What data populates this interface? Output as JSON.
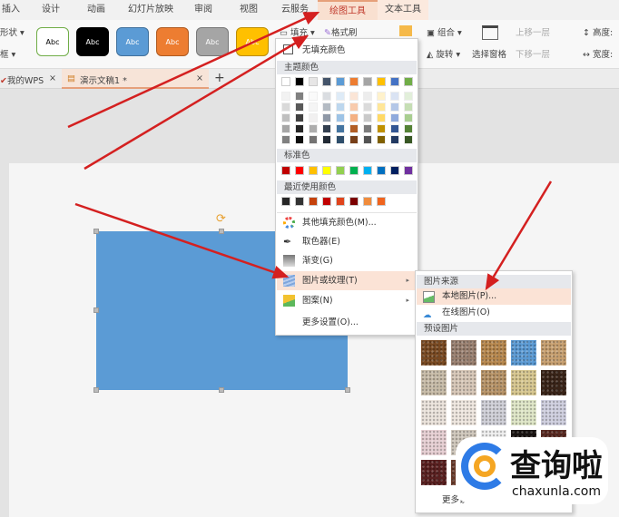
{
  "tabs": [
    {
      "label": "插入"
    },
    {
      "label": "设计"
    },
    {
      "label": "动画"
    },
    {
      "label": "幻灯片放映"
    },
    {
      "label": "审阅"
    },
    {
      "label": "视图"
    },
    {
      "label": "云服务"
    },
    {
      "label": "绘图工具"
    },
    {
      "label": "文本工具"
    }
  ],
  "ribbon": {
    "shape_label": "形状 ▾",
    "frame_label": "框 ▾",
    "style_text": "Abc",
    "styles": [
      {
        "bg": "#ffffff",
        "fg": "#000",
        "border": "#70ad47"
      },
      {
        "bg": "#000000",
        "fg": "#fff",
        "border": "#000"
      },
      {
        "bg": "#5b9bd5",
        "fg": "#fff",
        "border": "#41719c"
      },
      {
        "bg": "#ed7d31",
        "fg": "#fff",
        "border": "#ae5a21"
      },
      {
        "bg": "#a5a5a5",
        "fg": "#fff",
        "border": "#787878"
      },
      {
        "bg": "#ffc000",
        "fg": "#fff",
        "border": "#bc8c00"
      }
    ],
    "fill": "填充",
    "format_painter": "格式刷",
    "group": "组合",
    "rotate": "旋转",
    "selection_pane": "选择窗格",
    "bring_forward": "上移一层",
    "send_backward": "下移一层",
    "height": "高度:",
    "width": "宽度:"
  },
  "doctabs": {
    "my_wps": "我的WPS",
    "doc": "演示文稿1 *",
    "close": "×",
    "add": "+"
  },
  "fill_menu": {
    "no_fill": "无填充颜色",
    "theme_colors": "主题颜色",
    "theme_base": [
      "#ffffff",
      "#000000",
      "#e7e6e6",
      "#44546a",
      "#5b9bd5",
      "#ed7d31",
      "#a5a5a5",
      "#ffc000",
      "#4472c4",
      "#70ad47"
    ],
    "standard_colors": "标准色",
    "standard": [
      "#c00000",
      "#ff0000",
      "#ffc000",
      "#ffff00",
      "#92d050",
      "#00b050",
      "#00b0f0",
      "#0070c0",
      "#002060",
      "#7030a0"
    ],
    "recent_colors": "最近使用颜色",
    "recent": [
      "#262626",
      "#333333",
      "#c5420c",
      "#c00000",
      "#e0441c",
      "#7b0000",
      "#f08c3c",
      "#f0641e"
    ],
    "items": [
      {
        "label": "其他填充颜色(M)...",
        "icon": "color-wheel-icon"
      },
      {
        "label": "取色器(E)",
        "icon": "eyedropper-icon"
      },
      {
        "label": "渐变(G)",
        "icon": "gradient-icon"
      },
      {
        "label": "图片或纹理(T)",
        "icon": "texture-icon",
        "submenu": true
      },
      {
        "label": "图案(N)",
        "icon": "pattern-icon",
        "submenu": true
      },
      {
        "label": "更多设置(O)..."
      }
    ]
  },
  "picture_menu": {
    "source_header": "图片来源",
    "local": "本地图片(P)...",
    "online": "在线图片(O)",
    "preset_header": "预设图片",
    "more": "更多设置(O)...",
    "textures": [
      "#7a4a22",
      "#9a8070",
      "#b8884e",
      "#5b9bd5",
      "#c8a070",
      "#c8bca8",
      "#d8c8b8",
      "#b89468",
      "#d8c890",
      "#3a2418",
      "#ece4dc",
      "#f0e8e0",
      "#d0d0d8",
      "#e0e8c8",
      "#d0d0e0",
      "#e8d0d4",
      "#d0c8bc",
      "#f0f0f0",
      "#1a1412",
      "#5a2a22",
      "#5a2020",
      "#6a3a2a",
      "#e8e0d8",
      "#d8d0c8",
      "#c8c0b8"
    ]
  },
  "watermark": {
    "text": "查询啦",
    "url": "chaxunla.com"
  },
  "colors": {
    "accent": "#c0392b",
    "shape": "#5b9bd5",
    "arrow": "#d42020"
  }
}
